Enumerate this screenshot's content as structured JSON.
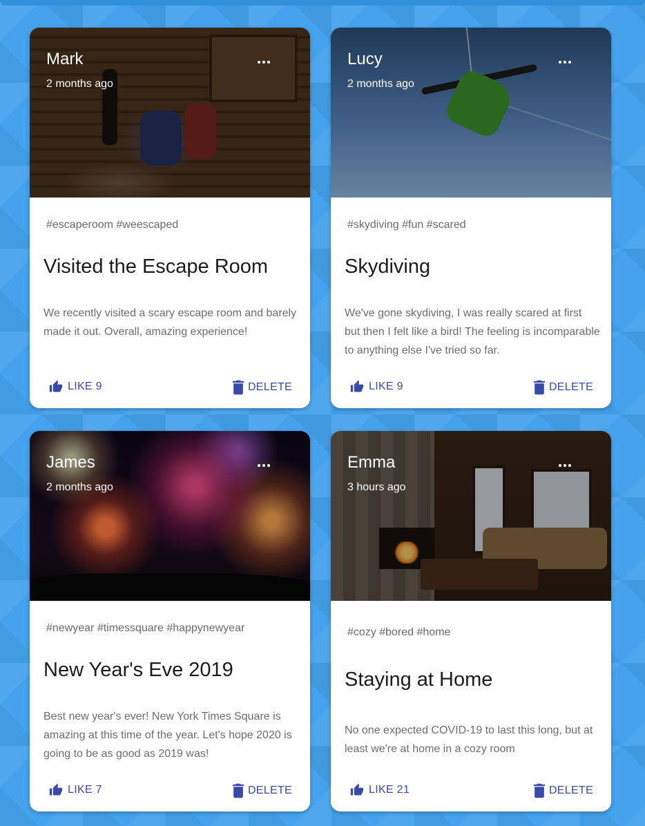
{
  "posts": [
    {
      "author": "Mark",
      "time": "2 months ago",
      "tags": "#escaperoom #weescaped",
      "title": "Visited the Escape Room",
      "message": "We recently visited a scary escape room and barely made it out. Overall, amazing experience!",
      "like_label": "LIKE 9",
      "delete_label": "DELETE",
      "image": "escape-room-photo"
    },
    {
      "author": "Lucy",
      "time": "2 months ago",
      "tags": "#skydiving #fun #scared",
      "title": "Skydiving",
      "message": "We've gone skydiving, I was really scared at first but then I felt like a bird! The feeling is incomparable to anything else I've tried so far.",
      "like_label": "LIKE 9",
      "delete_label": "DELETE",
      "image": "skydiving-photo"
    },
    {
      "author": "James",
      "time": "2 months ago",
      "tags": "#newyear #timessquare #happynewyear",
      "title": "New Year's Eve 2019",
      "message": "Best new year's ever! New York Times Square is amazing at this time of the year. Let's hope 2020 is going to be as good as 2019 was!",
      "like_label": "LIKE 7",
      "delete_label": "DELETE",
      "image": "fireworks-photo"
    },
    {
      "author": "Emma",
      "time": "3 hours ago",
      "tags": "#cozy #bored #home",
      "title": "Staying at Home",
      "message": "No one expected COVID-19 to last this long, but at least we're at home in a cozy room",
      "like_label": "LIKE 21",
      "delete_label": "DELETE",
      "image": "cozy-room-photo"
    }
  ],
  "colors": {
    "background": "#45a2ec",
    "action": "#3a4aa8",
    "card": "#ffffff"
  },
  "icons": {
    "like": "thumb-up-icon",
    "delete": "trash-icon",
    "more": "more-horizontal-icon"
  }
}
